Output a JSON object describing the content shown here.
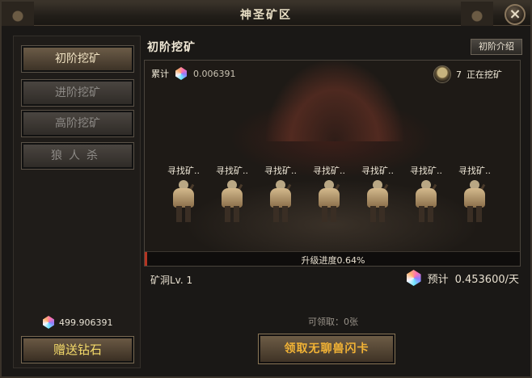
{
  "window": {
    "title": "神圣矿区",
    "close_label": "×"
  },
  "sidebar": {
    "tabs": [
      {
        "label": "初阶挖矿",
        "active": true
      },
      {
        "label": "进阶挖矿",
        "active": false
      },
      {
        "label": "高阶挖矿",
        "active": false
      },
      {
        "label": "狼人杀",
        "active": false
      }
    ],
    "diamond_total": "499.906391",
    "gift_button": "赠送钻石"
  },
  "main": {
    "section_title": "初阶挖矿",
    "intro_button": "初阶介绍",
    "accumulated_label": "累计",
    "accumulated_value": "0.006391",
    "miners_count": "7",
    "miners_status": "正在挖矿",
    "workers": [
      "寻找矿..",
      "寻找矿..",
      "寻找矿..",
      "寻找矿..",
      "寻找矿..",
      "寻找矿..",
      "寻找矿.."
    ],
    "progress_text": "升级进度0.64%",
    "progress_percent": 0.64,
    "level_text": "矿洞Lv. 1",
    "forecast_label": "预计",
    "forecast_value": "0.453600/天",
    "claimable_text": "可领取：0张",
    "claim_button": "领取无聊兽闪卡"
  },
  "colors": {
    "accent_gold": "#f2b335",
    "progress_red": "#b53522",
    "gift_yellow": "#f6dc6a"
  },
  "icons": {
    "diamond": "gem-icon",
    "miner": "miner-avatar-icon",
    "close": "close-icon"
  }
}
